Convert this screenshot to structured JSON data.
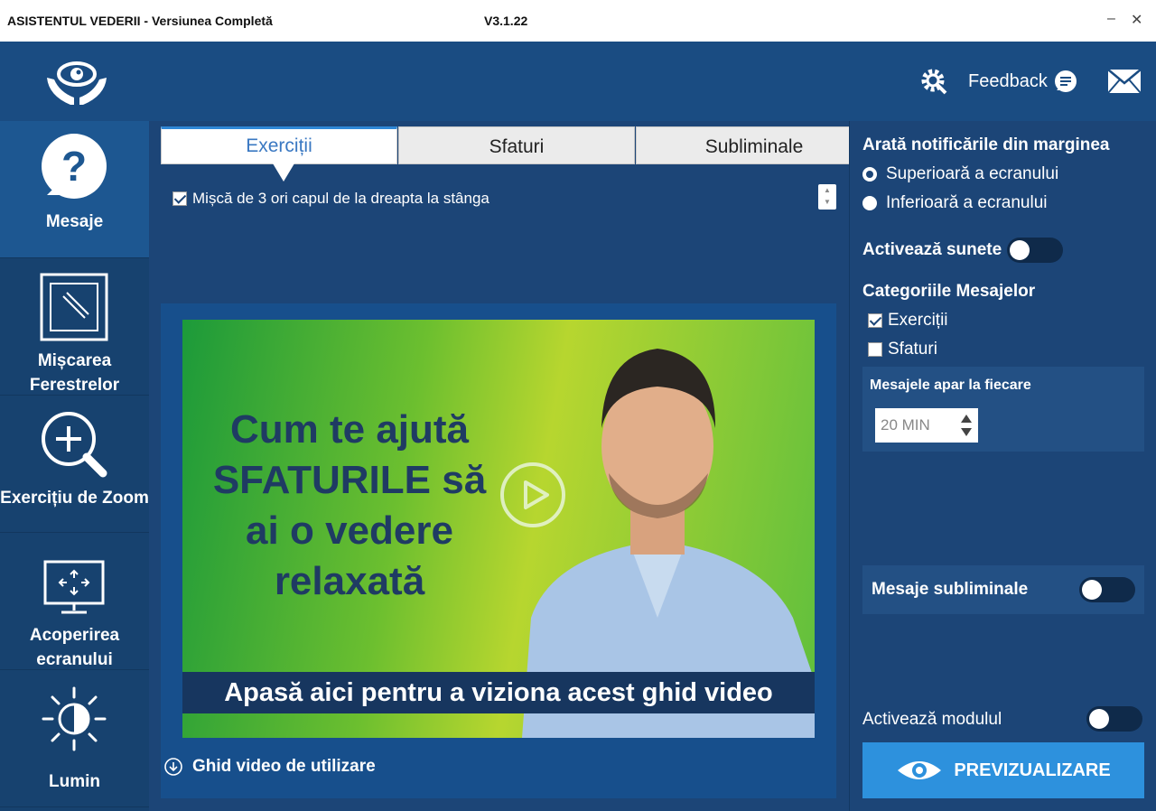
{
  "window": {
    "title": "ASISTENTUL VEDERII - Versiunea Completă",
    "version": "V3.1.22",
    "minimize": "–",
    "close": "✕"
  },
  "header": {
    "feedback_label": "Feedback"
  },
  "sidebar": {
    "items": [
      {
        "label": "Mesaje",
        "icon": "question-icon",
        "active": true
      },
      {
        "label": "Mișcarea Ferestrelor",
        "icon": "window-move-icon",
        "active": false
      },
      {
        "label": "Exercițiu de Zoom",
        "icon": "zoom-icon",
        "active": false
      },
      {
        "label": "Acoperirea ecranului",
        "icon": "screen-cover-icon",
        "active": false
      },
      {
        "label": "Lumin",
        "icon": "brightness-icon",
        "active": false
      }
    ]
  },
  "tabs": [
    {
      "label": "Exerciții",
      "active": true
    },
    {
      "label": "Sfaturi",
      "active": false
    },
    {
      "label": "Subliminale",
      "active": false
    }
  ],
  "messages": [
    {
      "text": "Mișcă de 3 ori capul de la dreapta la stânga",
      "checked": true
    }
  ],
  "video": {
    "headline": "Cum te ajută SFATURILE să ai o vedere relaxată",
    "banner": "Apasă aici pentru a viziona acest ghid video",
    "guide_link": "Ghid video de utilizare"
  },
  "settings": {
    "notif_heading": "Arată notificările din marginea",
    "notif_options": [
      {
        "label": "Superioară a ecranului",
        "checked": true
      },
      {
        "label": "Inferioară a ecranului",
        "checked": false
      }
    ],
    "sounds_label": "Activează sunete",
    "sounds_on": false,
    "categories_heading": "Categoriile Mesajelor",
    "categories": [
      {
        "label": "Exerciții",
        "checked": true
      },
      {
        "label": "Sfaturi",
        "checked": false
      }
    ],
    "interval_label": "Mesajele apar la fiecare",
    "interval_value": "20 MIN",
    "subliminal_label": "Mesaje subliminale",
    "subliminal_on": false,
    "module_label": "Activează modulul",
    "module_on": false,
    "preview_label": "PREVIZUALIZARE"
  },
  "colors": {
    "background": "#1c4577",
    "accent": "#2d91dd",
    "nav_active": "#1d5791"
  }
}
